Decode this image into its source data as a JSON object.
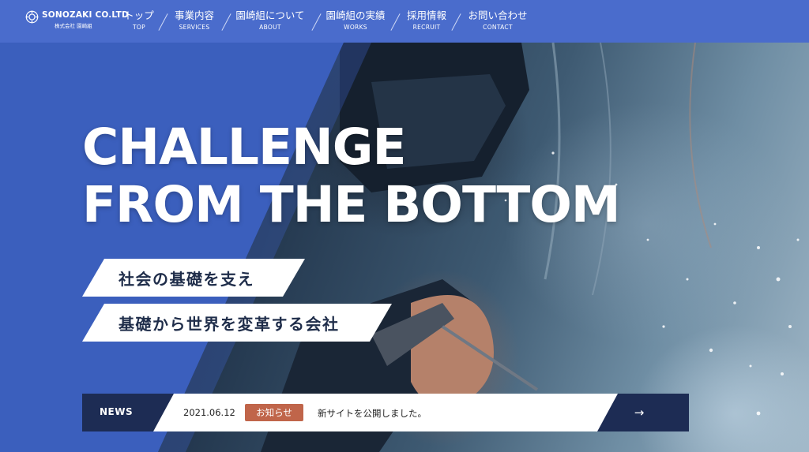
{
  "header": {
    "logo": {
      "title": "SONOZAKI CO.LTD",
      "subtitle": "株式会社 園崎組"
    },
    "nav": [
      {
        "jp": "トップ",
        "en": "TOP"
      },
      {
        "jp": "事業内容",
        "en": "SERVICES"
      },
      {
        "jp": "園崎組について",
        "en": "ABOUT"
      },
      {
        "jp": "園崎組の実績",
        "en": "WORKS"
      },
      {
        "jp": "採用情報",
        "en": "RECRUIT"
      },
      {
        "jp": "お問い合わせ",
        "en": "CONTACT"
      }
    ]
  },
  "hero": {
    "headline_line1": "CHALLENGE",
    "headline_line2": "FROM THE BOTTOM",
    "tagline_1": "社会の基礎を支え",
    "tagline_2": "基礎から世界を変革する会社"
  },
  "news": {
    "label": "NEWS",
    "date": "2021.06.12",
    "badge": "お知らせ",
    "text": "新サイトを公開しました。",
    "arrow_icon": "arrow-right-icon"
  },
  "colors": {
    "header_bg": "#4a6ccc",
    "overlay_blue": "#3b5fbd",
    "news_navy": "#1d2c54",
    "badge": "#c0654a",
    "tagline_text": "#1f2d4a"
  }
}
